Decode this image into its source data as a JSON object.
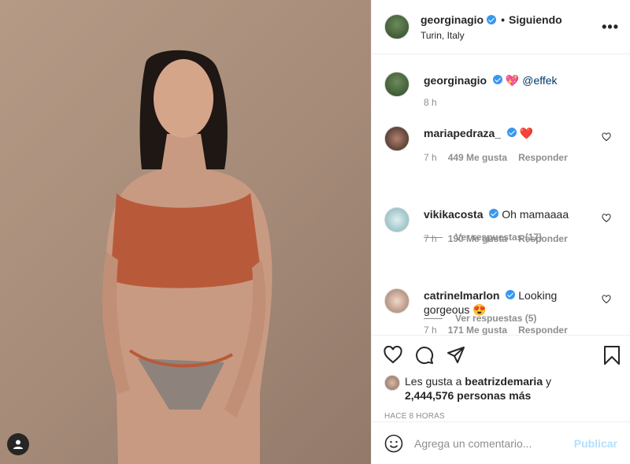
{
  "header": {
    "username": "georginagio",
    "separator": "•",
    "follow_status": "Siguiendo",
    "location": "Turin, Italy",
    "more_label": "•••"
  },
  "caption": {
    "username": "georginagio",
    "emoji": "💖",
    "mention": "@effek",
    "time": "8 h"
  },
  "comments": [
    {
      "username": "mariapedraza_",
      "text": "❤️",
      "time": "7 h",
      "likes": "449 Me gusta",
      "reply": "Responder",
      "replies": "Ver respuestas (17)"
    },
    {
      "username": "vikikacosta",
      "text": "Oh mamaaaa",
      "time": "7 h",
      "likes": "190 Me gusta",
      "reply": "Responder",
      "replies": "Ver respuestas (5)"
    },
    {
      "username": "catrinelmarlon",
      "text": "Looking",
      "text2": "gorgeous 😍",
      "time": "7 h",
      "likes": "171 Me gusta",
      "reply": "Responder"
    }
  ],
  "likes": {
    "prefix": "Les gusta a",
    "user": "beatrizdemaria",
    "joiner": "y",
    "count": "2,444,576 personas más"
  },
  "timestamp": "HACE 8 HORAS",
  "comment_box": {
    "placeholder": "Agrega un comentario...",
    "publish": "Publicar"
  },
  "colors": {
    "verified": "#3897f0",
    "publish_disabled": "#b2dffc",
    "muted": "#8e8e8e"
  }
}
